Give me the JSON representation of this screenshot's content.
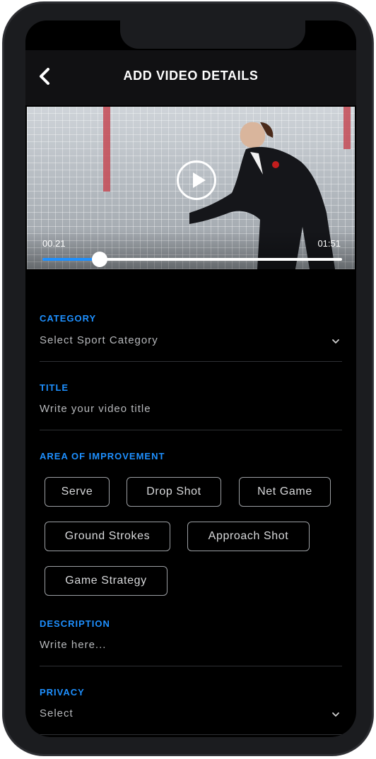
{
  "header": {
    "title": "ADD VIDEO DETAILS"
  },
  "video": {
    "current_time": "00.21",
    "duration": "01:51",
    "progress_fraction": 0.19
  },
  "category": {
    "label": "CATEGORY",
    "placeholder": "Select Sport Category"
  },
  "title_field": {
    "label": "TITLE",
    "placeholder": "Write your video title"
  },
  "improvement": {
    "label": "AREA OF IMPROVEMENT",
    "chips": [
      "Serve",
      "Drop Shot",
      "Net Game",
      "Ground Strokes",
      "Approach Shot",
      "Game Strategy"
    ]
  },
  "description": {
    "label": "DESCRIPTION",
    "placeholder": "Write here..."
  },
  "privacy": {
    "label": "PRIVACY",
    "placeholder": "Select"
  },
  "colors": {
    "accent": "#1e90ff",
    "background": "#000000",
    "bar": "#111113"
  }
}
